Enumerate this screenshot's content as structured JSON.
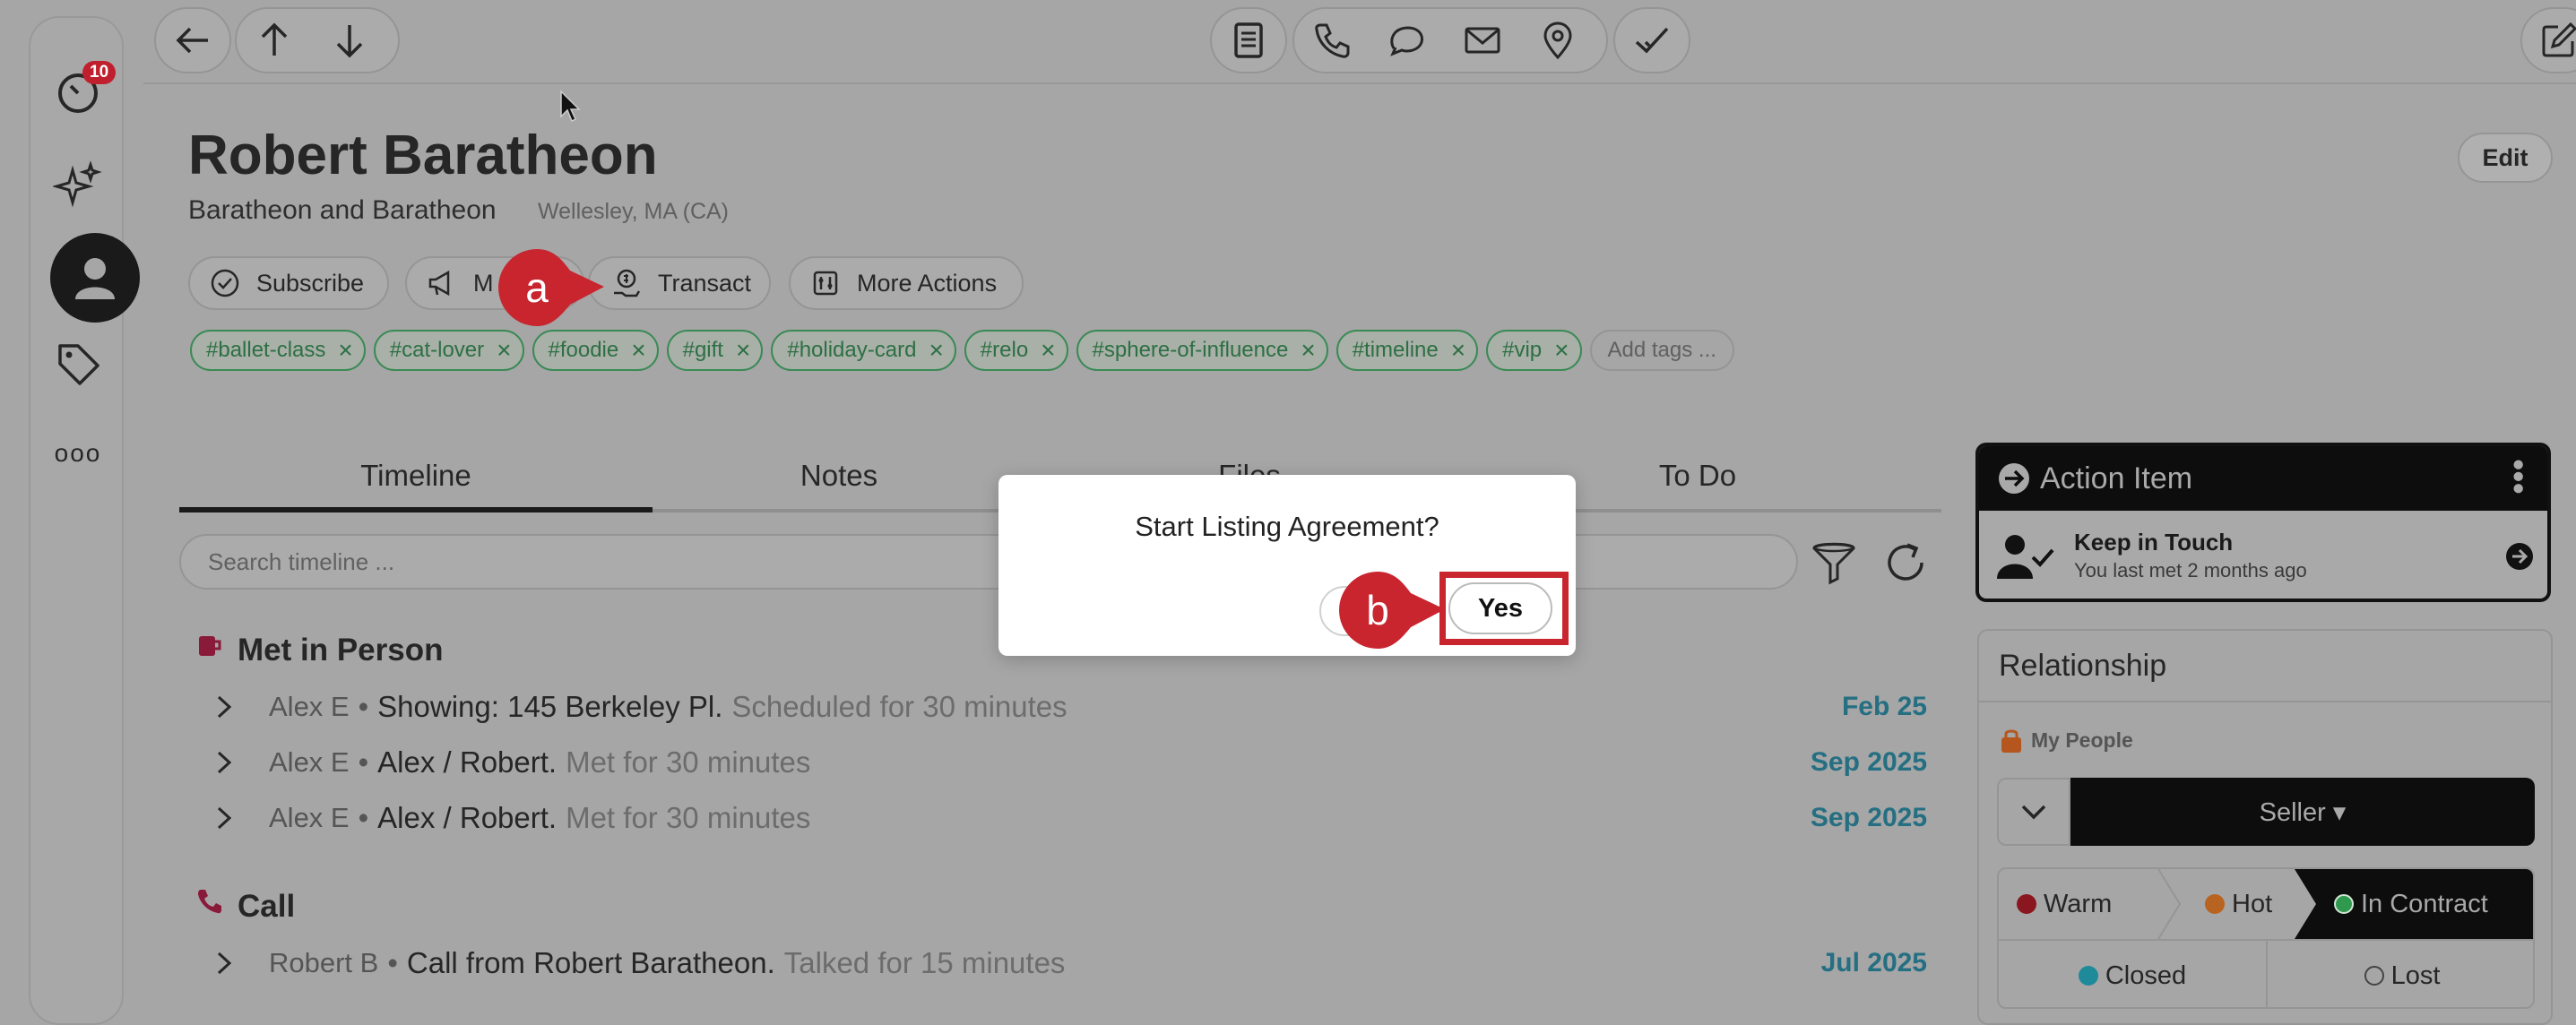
{
  "rail": {
    "badge_count": "10",
    "more_label": "ooo"
  },
  "contact": {
    "name": "Robert Baratheon",
    "company": "Baratheon and Baratheon",
    "location": "Wellesley, MA (CA)",
    "edit_label": "Edit"
  },
  "actions": {
    "subscribe": "Subscribe",
    "market": "M",
    "transact": "Transact",
    "more_actions": "More Actions"
  },
  "tags": [
    "#ballet-class",
    "#cat-lover",
    "#foodie",
    "#gift",
    "#holiday-card",
    "#relo",
    "#sphere-of-influence",
    "#timeline",
    "#vip"
  ],
  "tags_add": "Add tags ...",
  "tabs": {
    "timeline": "Timeline",
    "notes": "Notes",
    "files": "Files",
    "todo": "To Do"
  },
  "search": {
    "placeholder": "Search timeline ..."
  },
  "timeline": {
    "met_title": "Met in Person",
    "met_rows": [
      {
        "who": "Alex E",
        "desc": "Showing: 145 Berkeley Pl.",
        "meta": "Scheduled for 30 minutes",
        "date": "Feb 25"
      },
      {
        "who": "Alex E",
        "desc": "Alex / Robert.",
        "meta": "Met for 30 minutes",
        "date": "Sep 2025"
      },
      {
        "who": "Alex E",
        "desc": "Alex / Robert.",
        "meta": "Met for 30 minutes",
        "date": "Sep 2025"
      }
    ],
    "call_title": "Call",
    "call_rows": [
      {
        "who": "Robert B",
        "desc": "Call from Robert Baratheon.",
        "meta": "Talked for 15 minutes",
        "date": "Jul 2025"
      }
    ]
  },
  "action_item": {
    "title": "Action Item",
    "item_title": "Keep in Touch",
    "item_sub": "You last met 2 months ago"
  },
  "relationship": {
    "title": "Relationship",
    "privacy": "My People",
    "stage": "Seller ▾",
    "stages": {
      "warm": "Warm",
      "hot": "Hot",
      "in_contract": "In Contract",
      "closed": "Closed",
      "lost": "Lost"
    },
    "colors": {
      "warm": "#8a1620",
      "hot": "#b8631f",
      "in_contract": "#2f9a4d",
      "closed": "#1f8a9a"
    }
  },
  "dialog": {
    "question": "Start Listing Agreement?",
    "yes_label": "Yes"
  },
  "callouts": {
    "a": "a",
    "b": "b"
  },
  "colors": {
    "accent_red": "#c8252f",
    "tag_green": "#2d6f43",
    "date_teal": "#256f82"
  }
}
